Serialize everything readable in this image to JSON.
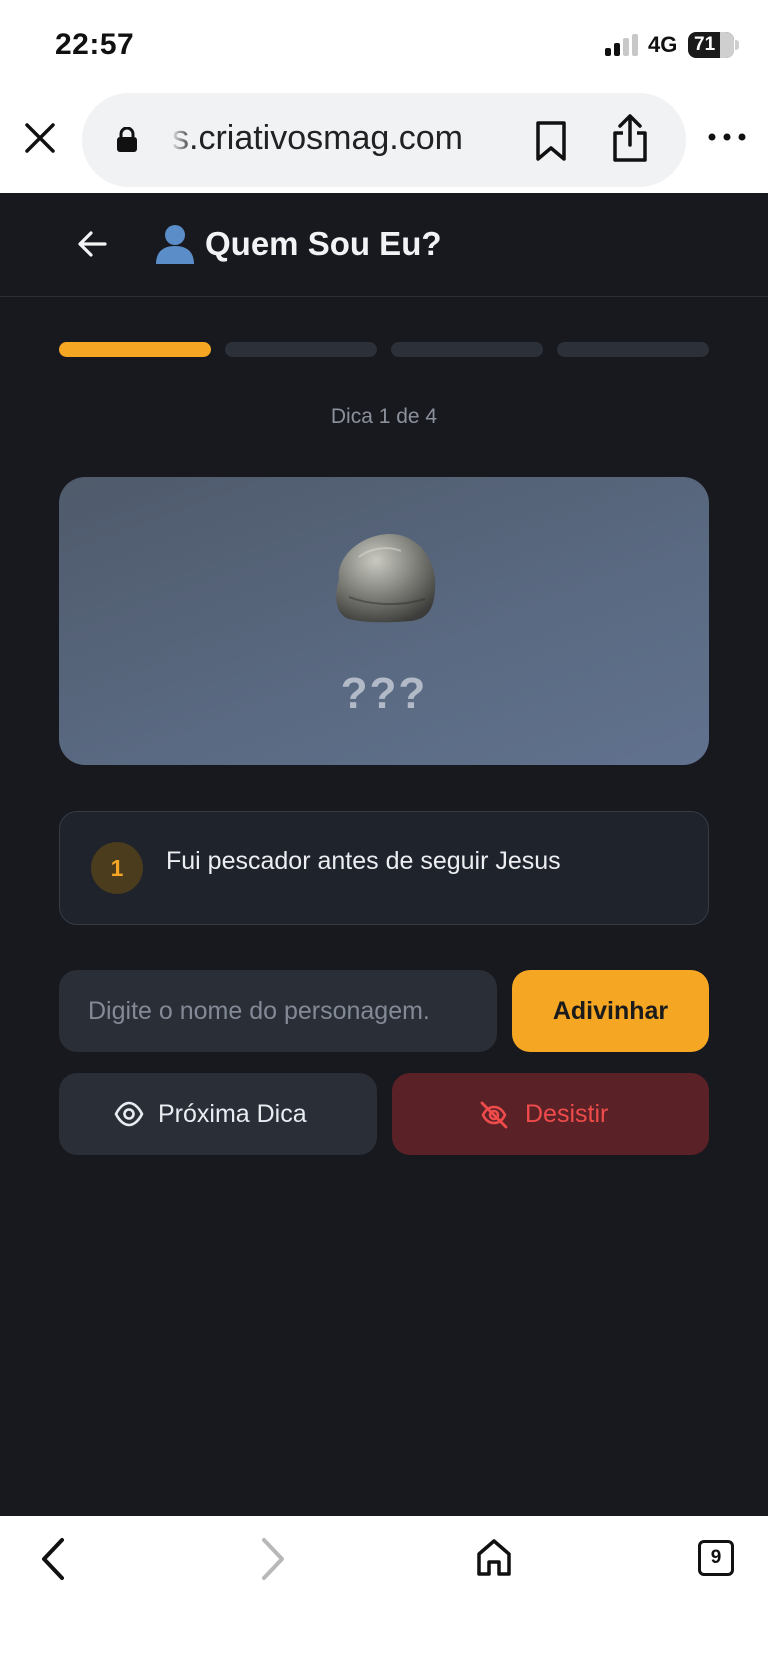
{
  "status_bar": {
    "time": "22:57",
    "network": "4G",
    "battery": "71"
  },
  "browser": {
    "url": "s.criativosmag.com"
  },
  "header": {
    "title": "Quem Sou Eu?"
  },
  "progress": {
    "current_hint": 1,
    "total_hints": 4,
    "label": "Dica 1 de 4"
  },
  "card": {
    "mystery_text": "???"
  },
  "hint": {
    "number": "1",
    "text": "Fui pescador antes de seguir Jesus"
  },
  "guess": {
    "placeholder": "Digite o nome do personagem.",
    "button": "Adivinhar"
  },
  "actions": {
    "next_hint": "Próxima Dica",
    "give_up": "Desistir"
  },
  "toolbar": {
    "tab_count": "9"
  },
  "colors": {
    "accent": "#f5a623",
    "background": "#18191f",
    "danger": "#ef4b4b",
    "danger_bg": "#5a2126"
  }
}
